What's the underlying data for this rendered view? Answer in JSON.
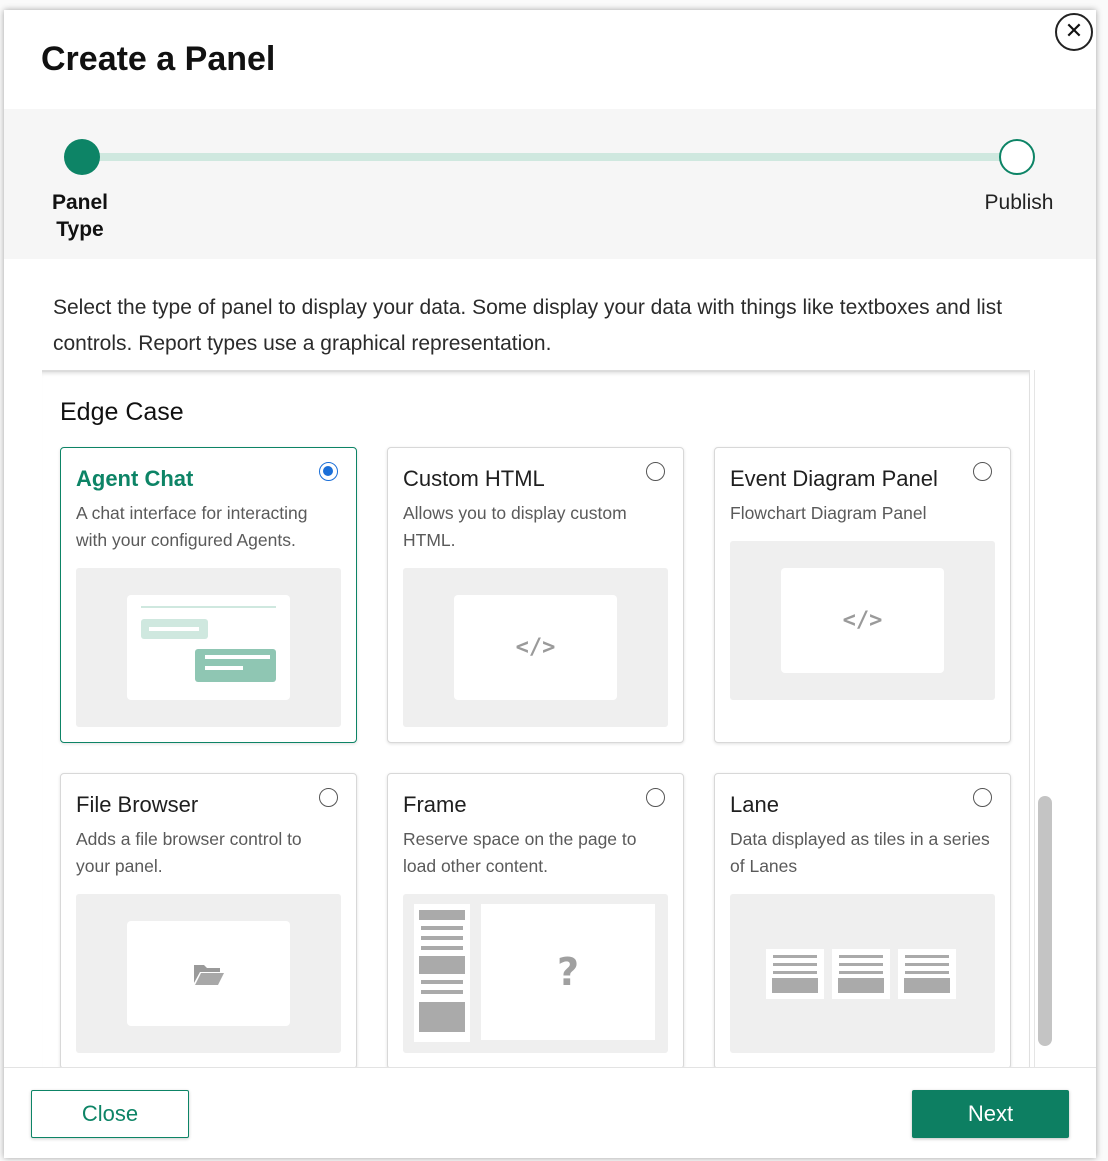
{
  "dialog": {
    "title": "Create a Panel",
    "close_icon": "close-icon"
  },
  "stepper": {
    "steps": [
      {
        "label": "Panel Type",
        "state": "active"
      },
      {
        "label": "Publish",
        "state": "pending"
      }
    ],
    "accent": "#0d8466"
  },
  "intro_text": "Select the type of panel to display your data. Some display your data with things like textboxes and list controls. Report types use a graphical representation.",
  "section": {
    "heading": "Edge Case",
    "cards": [
      {
        "title": "Agent Chat",
        "description": "A chat interface for interacting with your configured Agents.",
        "selected": true,
        "preview": "chat-preview-icon"
      },
      {
        "title": "Custom HTML",
        "description": "Allows you to display custom HTML.",
        "selected": false,
        "preview": "code-icon"
      },
      {
        "title": "Event Diagram Panel",
        "description": "Flowchart Diagram Panel",
        "selected": false,
        "preview": "code-icon"
      },
      {
        "title": "File Browser",
        "description": "Adds a file browser control to your panel.",
        "selected": false,
        "preview": "folder-icon"
      },
      {
        "title": "Frame",
        "description": "Reserve space on the page to load other content.",
        "selected": false,
        "preview": "question-icon"
      },
      {
        "title": "Lane",
        "description": "Data displayed as tiles in a series of Lanes",
        "selected": false,
        "preview": "lanes-icon"
      }
    ]
  },
  "footer": {
    "close_label": "Close",
    "next_label": "Next"
  }
}
